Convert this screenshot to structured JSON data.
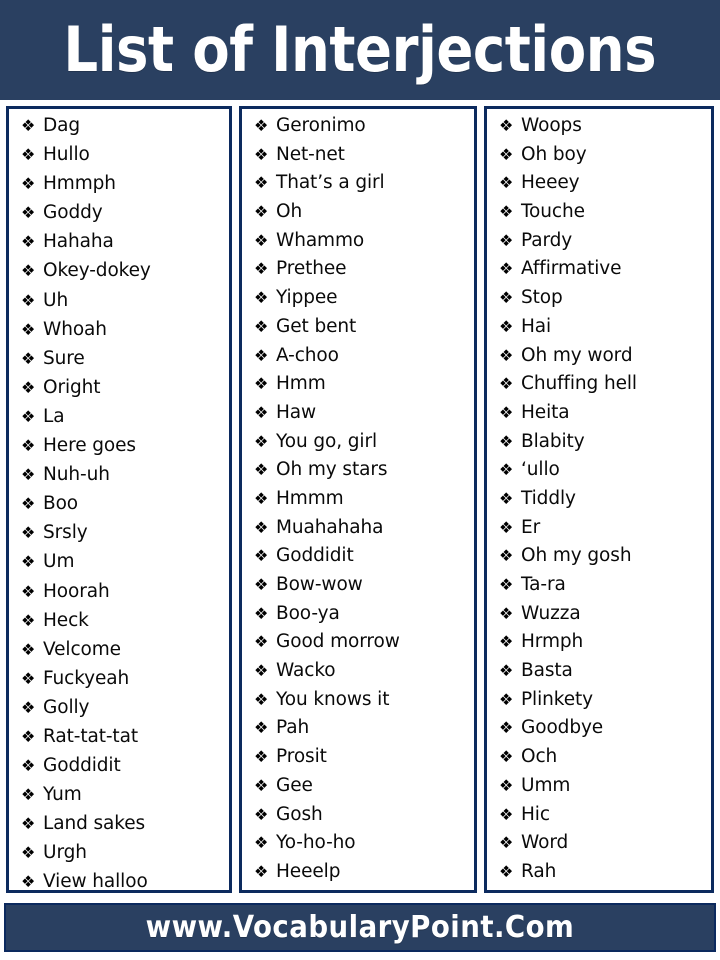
{
  "header": {
    "title": "List of Interjections",
    "background_color": "#2a4061",
    "text_color": "#ffffff"
  },
  "footer": {
    "website": "www.VocabularyPoint.Com",
    "background_color": "#2a4061",
    "border_color": "#0c2a5e",
    "text_color": "#ffffff"
  },
  "list": {
    "bullet_glyph": "❖",
    "border_color": "#0c2a5e",
    "text_color": "#0a0a0a",
    "columns": [
      {
        "id": "column-1",
        "items": [
          "Dag",
          "Hullo",
          "Hmmph",
          "Goddy",
          "Hahaha",
          "Okey-dokey",
          "Uh",
          "Whoah",
          "Sure",
          "Oright",
          "La",
          "Here goes",
          "Nuh-uh",
          "Boo",
          "Srsly",
          "Um",
          "Hoorah",
          "Heck",
          "Velcome",
          "Fuckyeah",
          "Golly",
          "Rat-tat-tat",
          "Goddidit",
          "Yum",
          "Land sakes",
          "Urgh",
          "View halloo"
        ]
      },
      {
        "id": "column-2",
        "items": [
          "Geronimo",
          "Net-net",
          "That’s a girl",
          "Oh",
          "Whammo",
          "Prethee",
          "Yippee",
          "Get bent",
          "A-choo",
          "Hmm",
          "Haw",
          "You go, girl",
          "Oh my stars",
          "Hmmm",
          "Muahahaha",
          "Goddidit",
          "Bow-wow",
          "Boo-ya",
          "Good morrow",
          "Wacko",
          "You knows it",
          "Pah",
          "Prosit",
          "Gee",
          "Gosh",
          "Yo-ho-ho",
          "Heeelp"
        ]
      },
      {
        "id": "column-3",
        "items": [
          "Woops",
          "Oh boy",
          "Heeey",
          "Touche",
          "Pardy",
          "Affirmative",
          "Stop",
          "Hai",
          "Oh my word",
          "Chuffing hell",
          "Heita",
          "Blabity",
          "‘ullo",
          "Tiddly",
          "Er",
          "Oh my gosh",
          "Ta-ra",
          "Wuzza",
          "Hrmph",
          "Basta",
          "Plinkety",
          "Goodbye",
          "Och",
          "Umm",
          "Hic",
          "Word",
          "Rah"
        ]
      }
    ]
  }
}
